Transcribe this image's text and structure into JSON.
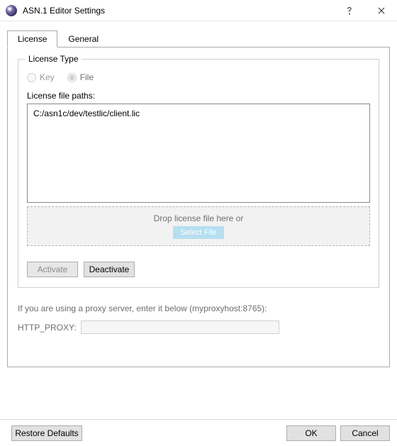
{
  "window": {
    "title": "ASN.1 Editor Settings"
  },
  "tabs": {
    "license": "License",
    "general": "General"
  },
  "license": {
    "group_title": "License Type",
    "radio_key": "Key",
    "radio_file": "File",
    "paths_label": "License file paths:",
    "paths_value": "C:/asn1c/dev/testlic/client.lic",
    "drop_text": "Drop license file here or",
    "select_file": "Select File",
    "activate": "Activate",
    "deactivate": "Deactivate"
  },
  "proxy": {
    "note": "If you are using a proxy server, enter it below (myproxyhost:8765):",
    "label": "HTTP_PROXY:",
    "value": ""
  },
  "footer": {
    "restore": "Restore Defaults",
    "ok": "OK",
    "cancel": "Cancel"
  }
}
